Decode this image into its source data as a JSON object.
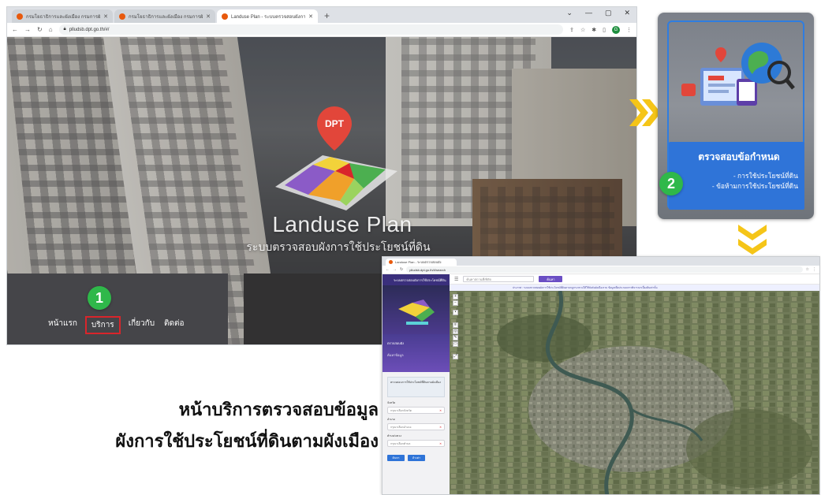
{
  "browser1": {
    "tabs": [
      {
        "title": "กรมโยธาธิการและผังเมือง กรมการผังเมือง",
        "active": false
      },
      {
        "title": "กรมโยธาธิการและผังเมือง กรมการผังเมือง",
        "active": false
      },
      {
        "title": "Landuse Plan - ระบบตรวจสอบผังการใช้",
        "active": true
      }
    ],
    "new_tab": "+",
    "window_controls": [
      "⌄",
      "—",
      "▢",
      "✕"
    ],
    "url": "plludsb.dpt.go.th/#/"
  },
  "hero": {
    "logo_badge": "DPT",
    "title": "Landuse Plan",
    "subtitle": "ระบบตรวจสอบผังการใช้ประโยชน์ที่ดิน",
    "step_badge": "1",
    "nav": [
      {
        "label": "หน้าแรก",
        "highlight": false
      },
      {
        "label": "บริการ",
        "highlight": true
      },
      {
        "label": "เกี่ยวกับ",
        "highlight": false
      },
      {
        "label": "ติดต่อ",
        "highlight": false
      }
    ]
  },
  "card": {
    "title": "ตรวจสอบข้อกำหนด",
    "items": [
      "- การใช้ประโยชน์ที่ดิน",
      "- ข้อห้ามการใช้ประโยชน์ที่ดิน"
    ],
    "step_badge": "2"
  },
  "browser2": {
    "tab_title": "Landuse Plan - ระบบตรวจสอบผัง",
    "url": "plludsb.dpt.go.th/#/search",
    "sidebar": {
      "header": "ระบบตรวจสอบผังการใช้ประโยชน์ที่ดิน",
      "menu_title": "ตรวจสอบผัง",
      "menu_sub": "ค้นหาข้อมูล",
      "note": "ตรวจสอบการใช้ประโยชน์ที่ดินตามผังเมือง",
      "fields": [
        {
          "label": "จังหวัด",
          "value": "กรุณาเลือกจังหวัด"
        },
        {
          "label": "อำเภอ",
          "value": "กรุณาเลือกอำเภอ"
        },
        {
          "label": "ตำบล/แขวง",
          "value": "กรุณาเลือกตำบล"
        }
      ],
      "buttons": [
        "ค้นหา",
        "ล้างค่า"
      ]
    },
    "search_placeholder": "ค้นหาสถานที่/พิกัด",
    "search_button": "ค้นหา",
    "ticker": "ประกาศ : ระบบตรวจสอบผังการใช้ประโยชน์ที่ดินตามกฎกระทรวงให้ใช้บังคับผังเมืองรวม ข้อมูลเพื่อประกอบการพิจารณาเบื้องต้นเท่านั้น"
  },
  "caption": {
    "line1": "หน้าบริการตรวจสอบข้อมูล",
    "line2": "ผังการใช้ประโยชน์ที่ดินตามผังเมือง"
  },
  "colors": {
    "step_badge": "#2fb84a",
    "highlight_border": "#d9252b",
    "chevron": "#f5c518",
    "card_panel": "#2f74d8",
    "app_purple": "#6b4fc4"
  }
}
